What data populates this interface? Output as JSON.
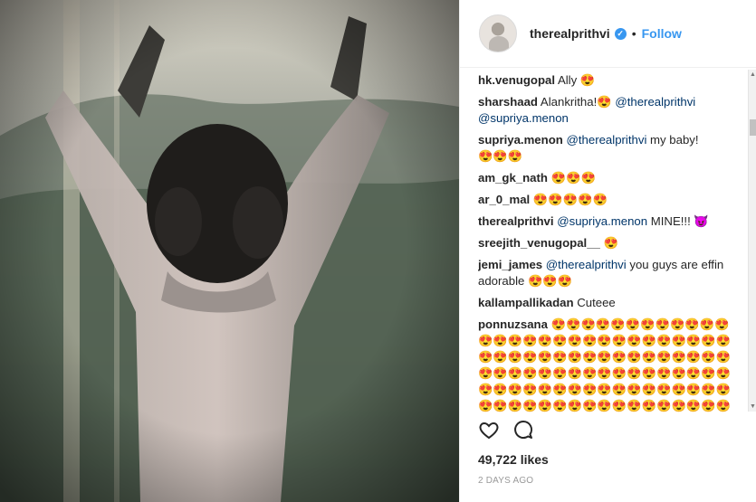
{
  "post": {
    "image_icon_name": "child-window-photo",
    "username": "therealprithvi",
    "verified_icon": "verified-badge-icon",
    "separator": "•",
    "follow_label": "Follow"
  },
  "comments": [
    {
      "user": "hk.venugopal",
      "text": "Ally",
      "emojis": "😍"
    },
    {
      "user": "sharshaad",
      "text": "Alankritha!",
      "emojis": "😍",
      "mentions": [
        "@therealprithvi",
        "@supriya.menon"
      ]
    },
    {
      "user": "supriya.menon",
      "mention": "@therealprithvi",
      "text": "my baby!",
      "emojis": "😍😍😍"
    },
    {
      "user": "am_gk_nath",
      "text": "",
      "emojis": "😍😍😍"
    },
    {
      "user": "ar_0_mal",
      "text": "",
      "emojis": "😍😍😍😍😍"
    },
    {
      "user": "therealprithvi",
      "mention": "@supriya.menon",
      "text": "MINE!!!",
      "emojis": "😈"
    },
    {
      "user": "sreejith_venugopal__",
      "text": "",
      "emojis": "😍"
    },
    {
      "user": "jemi_james",
      "mention": "@therealprithvi",
      "text": "you guys are effin adorable",
      "emojis": "😍😍😍"
    },
    {
      "user": "kallampallikadan",
      "text": "Cuteee",
      "emojis": ""
    },
    {
      "user": "ponnuzsana",
      "text": "",
      "emojis": "😍😍😍😍😍😍😍😍😍😍😍😍😍😍😍😍😍😍😍😍😍😍😍😍😍😍😍😍😍😍😍😍😍😍😍😍😍😍😍😍😍😍😍😍😍😍😍😍😍😍😍😍😍😍😍😍😍😍😍😍😍😍😍😍😍😍😍😍😍😍😍😍😍😍😍😍😍😍😍😍😍😍😍😍😍😍😍😍😍😍😍😍😍😍😍😍😍😍😍😍😍😍😍😍😍😍😍😍😍😍😍😍😍😍😍😍😍😍"
    }
  ],
  "actions": {
    "like_icon": "heart-icon",
    "comment_icon": "comment-icon"
  },
  "likes": "49,722 likes",
  "time": "2 DAYS AGO",
  "colors": {
    "accent": "#3897f0",
    "text": "#262626",
    "muted": "#999999"
  }
}
